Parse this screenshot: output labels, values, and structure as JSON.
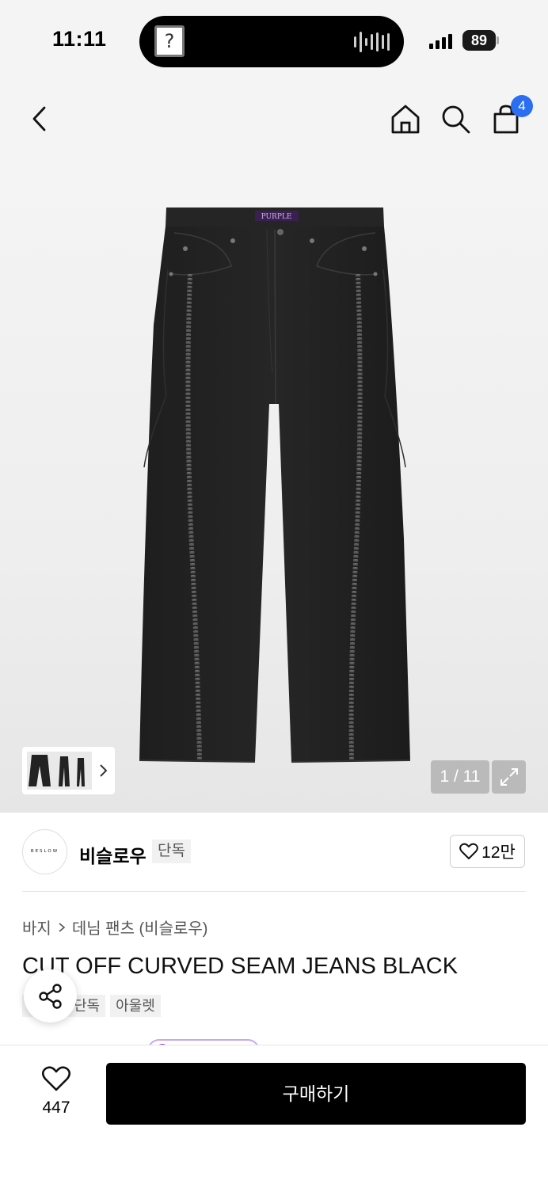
{
  "status_bar": {
    "time": "11:11",
    "island_thumb_glyph": "?",
    "battery": "89"
  },
  "nav": {
    "back_icon": "chevron-left-icon",
    "home_icon": "home-icon",
    "search_icon": "search-icon",
    "cart_icon": "shopping-bag-icon",
    "cart_count": "4",
    "badge_color": "#2a6ef2"
  },
  "gallery": {
    "waistband_label": "PURPLE",
    "counter": "1 / 11",
    "expand_icon": "expand-icon",
    "thumb_arrow_icon": "chevron-right-icon"
  },
  "brand": {
    "logo_text": "BESLOW",
    "name": "비슬로우",
    "tag": "단독",
    "likes": "12만"
  },
  "product": {
    "breadcrumb": [
      "바지",
      "데님 팬츠 (비슬로우)"
    ],
    "title": "CUT OFF CURVED SEAM JEANS BLACK",
    "tags": [
      "단독",
      "아울렛"
    ]
  },
  "share": {
    "icon": "share-icon"
  },
  "bottom_bar": {
    "like_count": "447",
    "buy_label": "구매하기"
  }
}
